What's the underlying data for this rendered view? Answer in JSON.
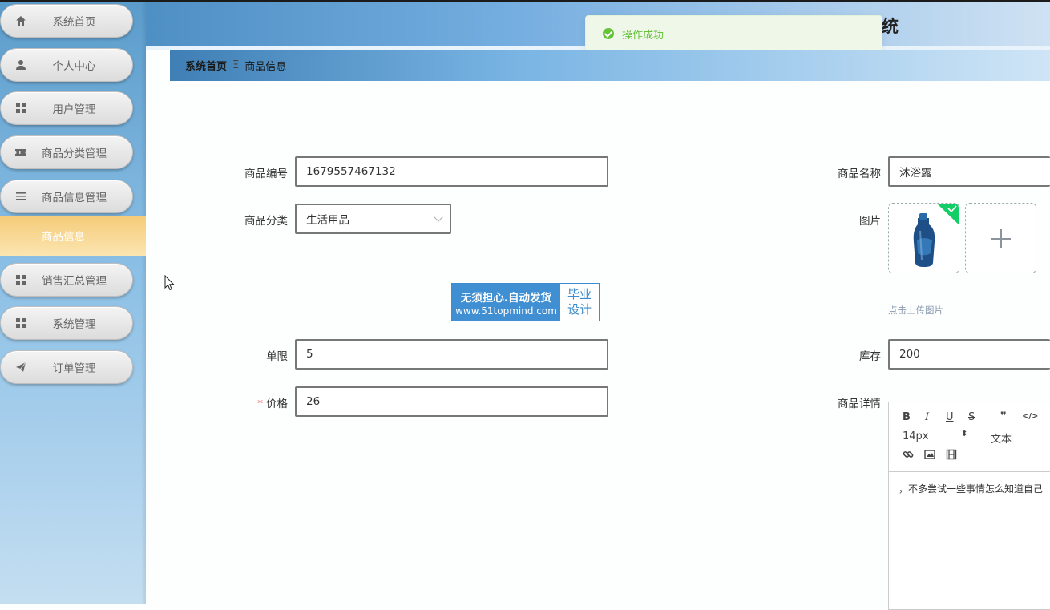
{
  "app": {
    "title_fragment": "统",
    "toast": "操作成功"
  },
  "sidebar": {
    "items": [
      {
        "label": "系统首页",
        "icon": "home-icon"
      },
      {
        "label": "个人中心",
        "icon": "user-icon"
      },
      {
        "label": "用户管理",
        "icon": "grid-icon"
      },
      {
        "label": "商品分类管理",
        "icon": "ticket-icon"
      },
      {
        "label": "商品信息管理",
        "icon": "list-icon"
      },
      {
        "label": "销售汇总管理",
        "icon": "grid-icon"
      },
      {
        "label": "系统管理",
        "icon": "grid-icon"
      },
      {
        "label": "订单管理",
        "icon": "send-icon"
      }
    ],
    "active_sub": "商品信息"
  },
  "breadcrumb": {
    "home": "系统首页",
    "separator": "Ξ",
    "current": "商品信息"
  },
  "form": {
    "product_no": {
      "label": "商品编号",
      "value": "1679557467132"
    },
    "product_name": {
      "label": "商品名称",
      "value": "沐浴露"
    },
    "category": {
      "label": "商品分类",
      "value": "生活用品"
    },
    "image": {
      "label": "图片",
      "tip": "点击上传图片"
    },
    "limit": {
      "label": "单限",
      "value": "5"
    },
    "stock": {
      "label": "库存",
      "value": "200"
    },
    "price": {
      "label": "价格",
      "required_mark": "*",
      "value": "26"
    },
    "details": {
      "label": "商品详情"
    }
  },
  "editor": {
    "bold": "B",
    "italic": "I",
    "underline": "U",
    "strike": "S",
    "quote": "❞",
    "code": "</>",
    "font_size": "14px",
    "header": "文本",
    "content": "，不多尝试一些事情怎么知道自己"
  },
  "watermark": {
    "line1": "无须担心.自动发货",
    "line2": "www.51topmind.com",
    "side1": "毕业",
    "side2": "设计"
  },
  "colors": {
    "sidebar_active": "#f5cb79",
    "toast_text": "#67c23a",
    "required": "#f56c6c",
    "header_start": "#4e8fc4"
  }
}
